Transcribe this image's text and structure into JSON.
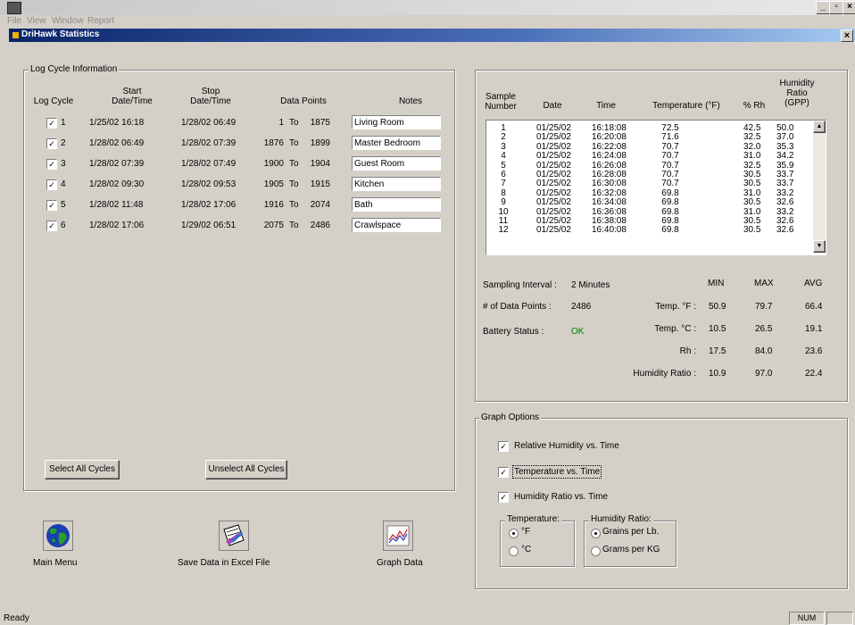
{
  "menu": [
    "File",
    "View",
    "Window",
    "Report"
  ],
  "window_title": "DriHawk Statistics",
  "log": {
    "group_label": "Log Cycle Information",
    "headers": {
      "cycle": "Log Cycle",
      "start": "Start Date/Time",
      "stop": "Stop Date/Time",
      "points": "Data Points",
      "notes": "Notes"
    },
    "rows": [
      {
        "check": "✓",
        "num": "1",
        "start": "1/25/02 16:18",
        "stop": "1/28/02 06:49",
        "from": "1",
        "to_label": "To",
        "to": "1875",
        "note": "Living Room"
      },
      {
        "check": "✓",
        "num": "2",
        "start": "1/28/02 06:49",
        "stop": "1/28/02 07:39",
        "from": "1876",
        "to_label": "To",
        "to": "1899",
        "note": "Master Bedroom"
      },
      {
        "check": "✓",
        "num": "3",
        "start": "1/28/02 07:39",
        "stop": "1/28/02 07:49",
        "from": "1900",
        "to_label": "To",
        "to": "1904",
        "note": "Guest Room"
      },
      {
        "check": "✓",
        "num": "4",
        "start": "1/28/02 09:30",
        "stop": "1/28/02 09:53",
        "from": "1905",
        "to_label": "To",
        "to": "1915",
        "note": "Kitchen"
      },
      {
        "check": "✓",
        "num": "5",
        "start": "1/28/02 11:48",
        "stop": "1/28/02 17:06",
        "from": "1916",
        "to_label": "To",
        "to": "2074",
        "note": "Bath"
      },
      {
        "check": "✓",
        "num": "6",
        "start": "1/28/02 17:06",
        "stop": "1/29/02 06:51",
        "from": "2075",
        "to_label": "To",
        "to": "2486",
        "note": "Crawlspace"
      }
    ],
    "select_all": "Select All Cycles",
    "unselect_all": "Unselect All Cycles"
  },
  "actions": {
    "main_menu": "Main Menu",
    "save_excel": "Save Data in Excel File",
    "graph": "Graph Data"
  },
  "samples": {
    "headers": {
      "number": "Sample Number",
      "date": "Date",
      "time": "Time",
      "temp": "Temperature (°F)",
      "rh": "% Rh",
      "ratio": "Humidity Ratio (GPP)"
    },
    "rows": [
      [
        "1",
        "01/25/02",
        "16:18:08",
        "72.5",
        "42.5",
        "50.0"
      ],
      [
        "2",
        "01/25/02",
        "16:20:08",
        "71.6",
        "32.5",
        "37.0"
      ],
      [
        "3",
        "01/25/02",
        "16:22:08",
        "70.7",
        "32.0",
        "35.3"
      ],
      [
        "4",
        "01/25/02",
        "16:24:08",
        "70.7",
        "31.0",
        "34.2"
      ],
      [
        "5",
        "01/25/02",
        "16:26:08",
        "70.7",
        "32.5",
        "35.9"
      ],
      [
        "6",
        "01/25/02",
        "16:28:08",
        "70.7",
        "30.5",
        "33.7"
      ],
      [
        "7",
        "01/25/02",
        "16:30:08",
        "70.7",
        "30.5",
        "33.7"
      ],
      [
        "8",
        "01/25/02",
        "16:32:08",
        "69.8",
        "31.0",
        "33.2"
      ],
      [
        "9",
        "01/25/02",
        "16:34:08",
        "69.8",
        "30.5",
        "32.6"
      ],
      [
        "10",
        "01/25/02",
        "16:36:08",
        "69.8",
        "31.0",
        "33.2"
      ],
      [
        "11",
        "01/25/02",
        "16:38:08",
        "69.8",
        "30.5",
        "32.6"
      ],
      [
        "12",
        "01/25/02",
        "16:40:08",
        "69.8",
        "30.5",
        "32.6"
      ]
    ]
  },
  "stats": {
    "interval_label": "Sampling Interval :",
    "interval_value": "2 Minutes",
    "points_label": "# of Data Points :",
    "points_value": "2486",
    "battery_label": "Battery Status :",
    "battery_value": "OK",
    "col_min": "MIN",
    "col_max": "MAX",
    "col_avg": "AVG",
    "rows": [
      {
        "label": "Temp. °F :",
        "min": "50.9",
        "max": "79.7",
        "avg": "66.4"
      },
      {
        "label": "Temp. °C :",
        "min": "10.5",
        "max": "26.5",
        "avg": "19.1"
      },
      {
        "label": "Rh :",
        "min": "17.5",
        "max": "84.0",
        "avg": "23.6"
      },
      {
        "label": "Humidity Ratio :",
        "min": "10.9",
        "max": "97.0",
        "avg": "22.4"
      }
    ],
    "ok_color": "#008000"
  },
  "graph_options": {
    "group_label": "Graph Options",
    "opt1": "Relative Humidity vs. Time",
    "opt2": "Temperature vs. Time",
    "opt3": "Humidity Ratio vs. Time",
    "check": "✓",
    "temp_group": "Temperature:",
    "temp_f": "°F",
    "temp_c": "°C",
    "ratio_group": "Humidity Ratio:",
    "ratio_lb": "Grains per Lb.",
    "ratio_kg": "Grams per KG"
  },
  "status": {
    "ready": "Ready",
    "num": "NUM"
  }
}
